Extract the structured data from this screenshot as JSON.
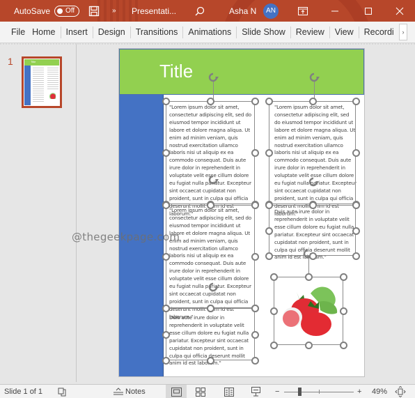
{
  "titlebar": {
    "autosave_label": "AutoSave",
    "autosave_state": "Off",
    "more_glyph": "»",
    "doc_title": "Presentati...",
    "user_name": "Asha N",
    "user_initials": "AN",
    "accent_color": "#b7472a"
  },
  "ribbon": {
    "tabs": [
      "File",
      "Home",
      "Insert",
      "Design",
      "Transitions",
      "Animations",
      "Slide Show",
      "Review",
      "View",
      "Recordi"
    ],
    "more_glyph": "›"
  },
  "thumbnails": {
    "items": [
      {
        "number": "1",
        "title": "Title",
        "selected": true
      }
    ]
  },
  "slide": {
    "title": "Title",
    "header_color": "#92d050",
    "sidebar_color": "#4472c4",
    "text_boxes": {
      "left_top": "\"Lorem ipsum dolor sit amet, consectetur adipiscing elit, sed do eiusmod tempor incididunt ut labore et dolore magna aliqua. Ut enim ad minim veniam, quis nostrud exercitation ullamco laboris nisi ut aliquip ex ea commodo consequat. Duis aute irure dolor in reprehenderit in voluptate velit esse cillum dolore eu fugiat nulla pariatur. Excepteur sint occaecat cupidatat non proident, sunt in culpa qui officia deserunt mollit anim id est laborum.\"",
      "left_middle": "\"Lorem ipsum dolor sit amet, consectetur adipiscing elit, sed do eiusmod tempor incididunt ut labore et dolore magna aliqua. Ut enim ad minim veniam, quis nostrud exercitation ullamco laboris nisi ut aliquip ex ea commodo consequat. Duis aute irure dolor in reprehenderit in voluptate velit esse cillum dolore eu fugiat nulla pariatur. Excepteur sint occaecat cupidatat non proident, sunt in culpa qui officia deserunt mollit anim id est laborum.\"",
      "left_bottom": "Duis aute irure dolor in reprehenderit in voluptate velit esse cillum dolore eu fugiat nulla pariatur. Excepteur sint occaecat cupidatat non proident, sunt in culpa qui officia deserunt mollit anim id est laborum.\"",
      "right_top": "\"Lorem ipsum dolor sit amet, consectetur adipiscing elit, sed do eiusmod tempor incididunt ut labore et dolore magna aliqua. Ut enim ad minim veniam, quis nostrud exercitation ullamco laboris nisi ut aliquip ex ea commodo consequat. Duis aute irure dolor in reprehenderit in voluptate velit esse cillum dolore eu fugiat nulla pariatur. Excepteur sint occaecat cupidatat non proident, sunt in culpa qui officia deserunt mollit anim id est laborum.\"",
      "right_middle": "Duis aute irure dolor in reprehenderit in voluptate velit esse cillum dolore eu fugiat nulla pariatur. Excepteur sint occaecat cupidatat non proident, sunt in culpa qui officia deserunt mollit anim id est laborum.\""
    },
    "image": {
      "description": "strawberries"
    }
  },
  "watermark": "@thegeekpage.com",
  "statusbar": {
    "slide_info": "Slide 1 of 1",
    "notes_label": "Notes",
    "zoom_percent": "49%",
    "zoom_value": 49,
    "zoom_minus": "−",
    "zoom_plus": "+"
  }
}
